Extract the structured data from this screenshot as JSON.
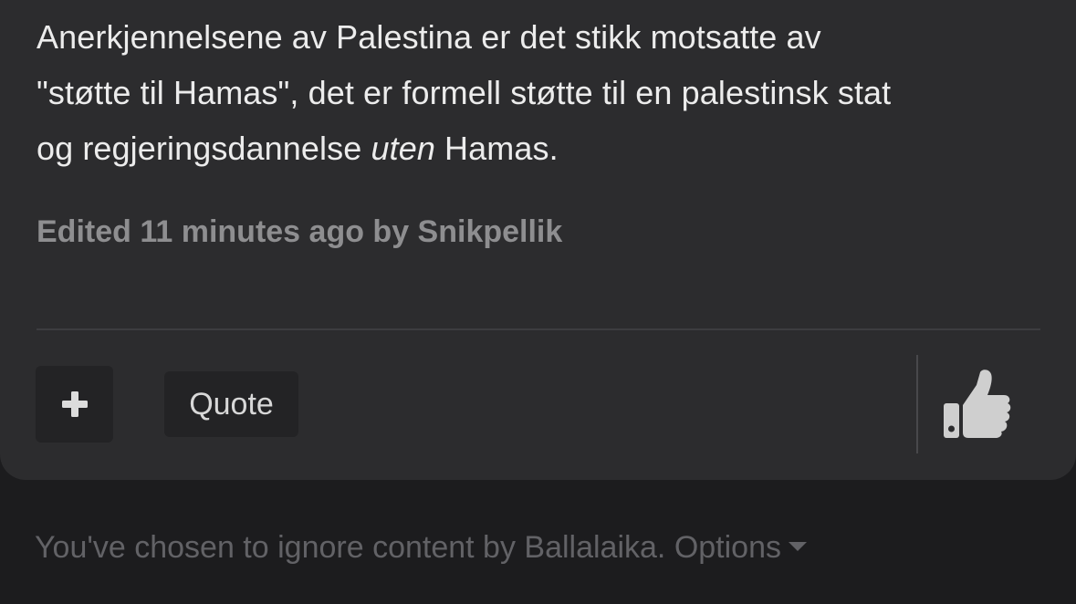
{
  "post": {
    "line1": "Anerkjennelsene av Palestina er det stikk motsatte av",
    "line2": "\"støtte til Hamas\", det er formell støtte til en palestinsk stat",
    "line3_pre": "og regjeringsdannelse ",
    "line3_em": "uten",
    "line3_post": " Hamas.",
    "edited_note": "Edited 11 minutes ago by Snikpellik"
  },
  "actions": {
    "plus_icon": "plus-icon",
    "quote_label": "Quote",
    "like_icon": "thumbs-up-icon"
  },
  "ignored": {
    "text": "You've chosen to ignore content by Ballalaika. ",
    "options_label": "Options",
    "options_icon": "caret-down-icon"
  }
}
